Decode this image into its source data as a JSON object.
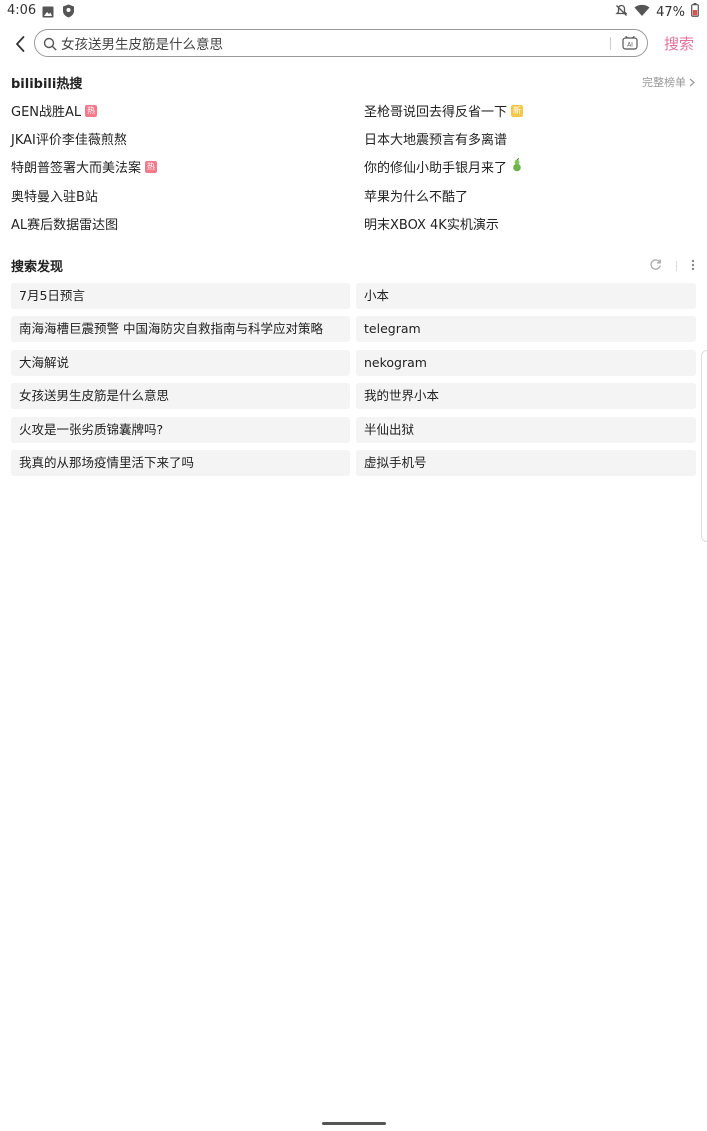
{
  "status": {
    "time": "4:06",
    "battery": "47%"
  },
  "search": {
    "value": "女孩送男生皮筋是什么意思",
    "button_label": "搜索"
  },
  "hot": {
    "title": "bilibili热搜",
    "full_rank_label": "完整榜单",
    "items": [
      {
        "label": "GEN战胜AL",
        "badge": "热"
      },
      {
        "label": "圣枪哥说回去得反省一下",
        "badge": "新"
      },
      {
        "label": "JKAI评价李佳薇煎熬",
        "badge": ""
      },
      {
        "label": "日本大地震预言有多离谱",
        "badge": ""
      },
      {
        "label": "特朗普签署大而美法案",
        "badge": "热"
      },
      {
        "label": "你的修仙小助手银月来了",
        "badge": ""
      },
      {
        "label": "奥特曼入驻B站",
        "badge": ""
      },
      {
        "label": "苹果为什么不酷了",
        "badge": ""
      },
      {
        "label": "AL赛后数据雷达图",
        "badge": ""
      },
      {
        "label": "明末XBOX 4K实机演示",
        "badge": ""
      }
    ]
  },
  "discovery": {
    "title": "搜索发现",
    "items": [
      "7月5日预言",
      "小本",
      "南海海槽巨震预警 中国海防灾自救指南与科学应对策略",
      "telegram",
      "大海解说",
      "nekogram",
      "女孩送男生皮筋是什么意思",
      "我的世界小本",
      "火攻是一张劣质锦囊牌吗?",
      "半仙出狱",
      "我真的从那场疫情里活下来了吗",
      "虚拟手机号"
    ]
  },
  "colors": {
    "accent": "#e3719b",
    "hot_badge": "#f37a8a",
    "new_badge": "#f4c84a"
  }
}
